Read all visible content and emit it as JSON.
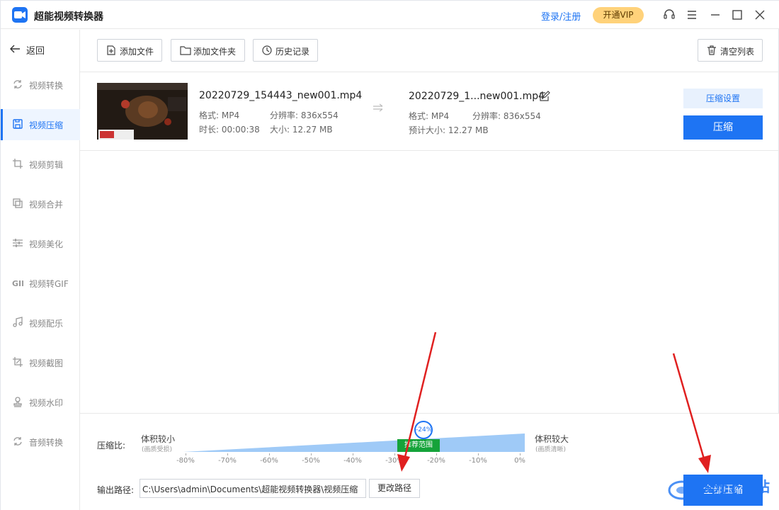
{
  "app": {
    "title": "超能视频转换器",
    "login_label": "登录/注册",
    "vip_label": "开通VIP"
  },
  "sidebar": {
    "back_label": "返回",
    "items": [
      {
        "label": "视频转换",
        "icon": "refresh-icon",
        "active": false
      },
      {
        "label": "视频压缩",
        "icon": "compress-icon",
        "active": true
      },
      {
        "label": "视频剪辑",
        "icon": "crop-icon",
        "active": false
      },
      {
        "label": "视频合并",
        "icon": "merge-icon",
        "active": false
      },
      {
        "label": "视频美化",
        "icon": "sliders-icon",
        "active": false
      },
      {
        "label": "视频转GIF",
        "icon": "gif-icon",
        "active": false
      },
      {
        "label": "视频配乐",
        "icon": "music-icon",
        "active": false
      },
      {
        "label": "视频截图",
        "icon": "screenshot-icon",
        "active": false
      },
      {
        "label": "视频水印",
        "icon": "stamp-icon",
        "active": false
      },
      {
        "label": "音频转换",
        "icon": "audio-convert-icon",
        "active": false
      }
    ]
  },
  "toolbar": {
    "add_file": "添加文件",
    "add_folder": "添加文件夹",
    "history": "历史记录",
    "clear_list": "清空列表"
  },
  "file": {
    "src_name": "20220729_154443_new001.mp4",
    "src_format": "格式:  MP4",
    "src_resolution": "分辨率:  836x554",
    "src_duration": "时长:  00:00:38",
    "src_size": "大小:  12.27 MB",
    "dst_name": "20220729_1...new001.mp4",
    "dst_format": "格式:  MP4",
    "dst_resolution": "分辨率:  836x554",
    "dst_size": "预计大小:  12.27 MB",
    "settings_label": "压缩设置",
    "compress_label": "压缩"
  },
  "compression": {
    "ratio_label": "压缩比:",
    "left_label": "体积较小",
    "left_sub": "(画质受损)",
    "right_label": "体积较大",
    "right_sub": "(画质清晰)",
    "recommend_label": "推荐范围",
    "value_label": "-24%",
    "value": -24,
    "ticks": [
      "-80%",
      "-70%",
      "-60%",
      "-50%",
      "-40%",
      "-30%",
      "-20%",
      "-10%",
      "0%"
    ]
  },
  "output": {
    "label": "输出路径:",
    "path": "C:\\Users\\admin\\Documents\\超能视频转换器\\视频压缩",
    "change_label": "更改路径",
    "compress_all_label": "全部压缩"
  },
  "watermark": {
    "text": "极光下载站"
  },
  "colors": {
    "accent": "#1e74f3",
    "recommend": "#15a33a",
    "vip": "#ffd27a",
    "annotation": "#e02020"
  }
}
